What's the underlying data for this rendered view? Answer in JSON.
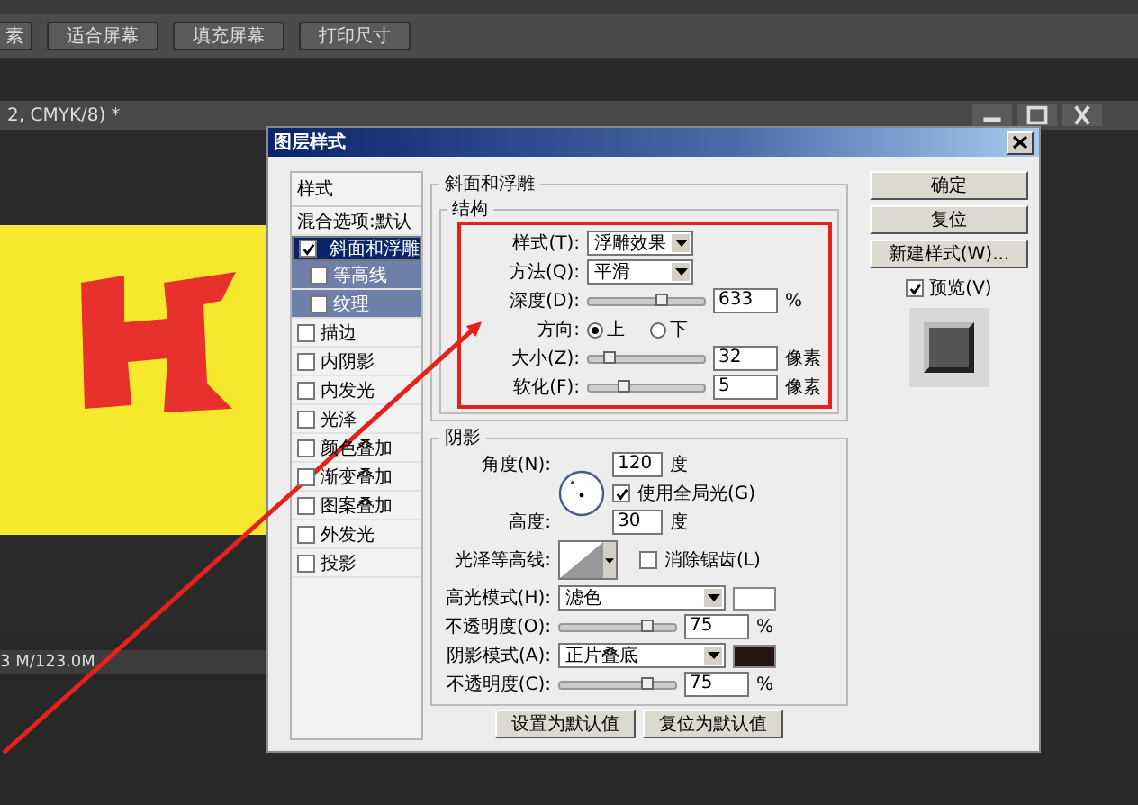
{
  "toolbar": {
    "buttons": [
      "素",
      "适合屏幕",
      "填充屏幕",
      "打印尺寸"
    ]
  },
  "document": {
    "tab_title": "2, CMYK/8) *",
    "status": "3 M/123.0M"
  },
  "dialog": {
    "title": "图层样式",
    "styles_header": "样式",
    "style_items": [
      {
        "label": "混合选项:默认",
        "kind": "plain",
        "selected": false
      },
      {
        "label": "斜面和浮雕",
        "kind": "check",
        "checked": true,
        "selected": true,
        "children": [
          {
            "label": "等高线",
            "checked": false
          },
          {
            "label": "纹理",
            "checked": false
          }
        ]
      },
      {
        "label": "描边",
        "kind": "check",
        "checked": false,
        "selected": false
      },
      {
        "label": "内阴影",
        "kind": "check",
        "checked": false,
        "selected": false
      },
      {
        "label": "内发光",
        "kind": "check",
        "checked": false,
        "selected": false
      },
      {
        "label": "光泽",
        "kind": "check",
        "checked": false,
        "selected": false
      },
      {
        "label": "颜色叠加",
        "kind": "check",
        "checked": false,
        "selected": false
      },
      {
        "label": "渐变叠加",
        "kind": "check",
        "checked": false,
        "selected": false
      },
      {
        "label": "图案叠加",
        "kind": "check",
        "checked": false,
        "selected": false
      },
      {
        "label": "外发光",
        "kind": "check",
        "checked": false,
        "selected": false
      },
      {
        "label": "投影",
        "kind": "check",
        "checked": false,
        "selected": false
      }
    ],
    "section_title": "斜面和浮雕",
    "structure": {
      "title": "结构",
      "style": {
        "label": "样式(T):",
        "value": "浮雕效果"
      },
      "technique": {
        "label": "方法(Q):",
        "value": "平滑"
      },
      "depth": {
        "label": "深度(D):",
        "level": 0.62,
        "value": "633",
        "unit": "%"
      },
      "direction": {
        "label": "方向:",
        "options": [
          {
            "label": "上",
            "selected": true
          },
          {
            "label": "下",
            "selected": false
          }
        ]
      },
      "size": {
        "label": "大小(Z):",
        "level": 0.17,
        "value": "32",
        "unit": "像素"
      },
      "soften": {
        "label": "软化(F):",
        "level": 0.3,
        "value": "5",
        "unit": "像素"
      }
    },
    "shading": {
      "title": "阴影",
      "angle": {
        "label": "角度(N):",
        "value": "120",
        "unit": "度"
      },
      "global_light": {
        "label": "使用全局光(G)",
        "checked": true
      },
      "altitude": {
        "label": "高度:",
        "value": "30",
        "unit": "度"
      },
      "gloss_contour": {
        "label": "光泽等高线:"
      },
      "anti_alias": {
        "label": "消除锯齿(L)",
        "checked": false
      },
      "highlight_mode": {
        "label": "高光模式(H):",
        "value": "滤色",
        "color": "#ffffff"
      },
      "highlight_opacity": {
        "label": "不透明度(O):",
        "level": 0.75,
        "value": "75",
        "unit": "%"
      },
      "shadow_mode": {
        "label": "阴影模式(A):",
        "value": "正片叠底",
        "color": "#231815"
      },
      "shadow_opacity": {
        "label": "不透明度(C):",
        "level": 0.75,
        "value": "75",
        "unit": "%"
      }
    },
    "bottom_buttons": [
      "设置为默认值",
      "复位为默认值"
    ],
    "side_buttons": [
      "确定",
      "复位",
      "新建样式(W)..."
    ],
    "preview": {
      "label": "预览(V)",
      "checked": true
    }
  }
}
